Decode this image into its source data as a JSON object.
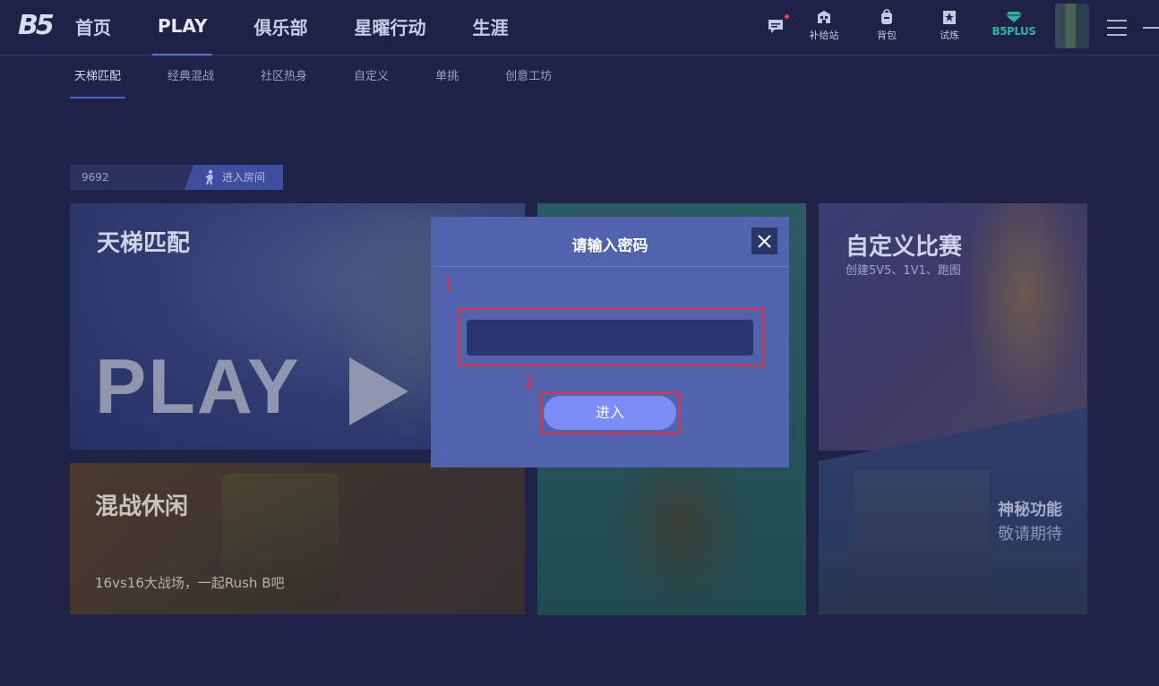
{
  "header": {
    "logo_text": "B5",
    "nav": [
      {
        "label": "首页"
      },
      {
        "label": "PLAY"
      },
      {
        "label": "俱乐部"
      },
      {
        "label": "星曜行动"
      },
      {
        "label": "生涯"
      }
    ],
    "tools": [
      {
        "label": "补给站",
        "icon": "store-icon"
      },
      {
        "label": "背包",
        "icon": "backpack-icon"
      },
      {
        "label": "试炼",
        "icon": "trial-star-icon"
      }
    ],
    "plus_label": "B5PLUS"
  },
  "subnav": {
    "items": [
      {
        "label": "天梯匹配"
      },
      {
        "label": "经典混战"
      },
      {
        "label": "社区热身"
      },
      {
        "label": "自定义"
      },
      {
        "label": "单挑"
      },
      {
        "label": "创意工坊"
      }
    ]
  },
  "room": {
    "id": "9692",
    "enter_label": "进入房间"
  },
  "cards": {
    "ladder": {
      "title": "天梯匹配",
      "big_text": "PLAY"
    },
    "melee": {
      "title": "混战休闲",
      "desc": "16vs16大战场，一起Rush B吧"
    },
    "custom": {
      "title": "自定义比赛",
      "desc": "创建5V5、1V1、跑图"
    },
    "mystery": {
      "title": "神秘功能",
      "desc": "敬请期待"
    }
  },
  "modal": {
    "title": "请输入密码",
    "password_value": "",
    "enter_label": "进入",
    "annotation_1": "1",
    "annotation_2": "2"
  },
  "colors": {
    "background": "#1e2347",
    "modal": "#5263ae",
    "enter_button": "#7a8cf6",
    "annotation": "#e8303a",
    "plus_accent": "#2fb3a0"
  }
}
